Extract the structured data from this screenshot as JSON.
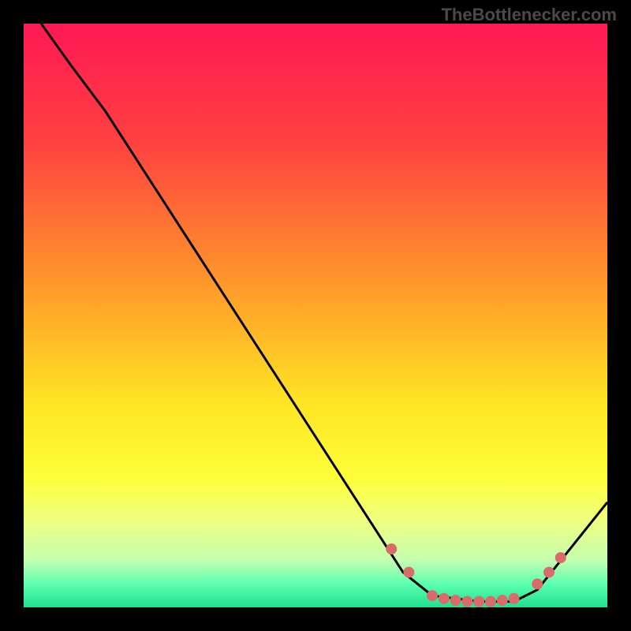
{
  "watermark": "TheBottlenecker.com",
  "chart_data": {
    "type": "line",
    "title": "",
    "xlabel": "",
    "ylabel": "",
    "xlim": [
      0,
      100
    ],
    "ylim": [
      0,
      100
    ],
    "series": [
      {
        "name": "curve",
        "color": "#000000",
        "points": [
          {
            "x": 3,
            "y": 100
          },
          {
            "x": 8,
            "y": 93
          },
          {
            "x": 14,
            "y": 85
          },
          {
            "x": 65,
            "y": 6
          },
          {
            "x": 70,
            "y": 2
          },
          {
            "x": 78,
            "y": 1
          },
          {
            "x": 84,
            "y": 1
          },
          {
            "x": 88,
            "y": 3
          },
          {
            "x": 100,
            "y": 18
          }
        ]
      }
    ],
    "markers": [
      {
        "x": 63,
        "y": 10,
        "color": "#d96b6b"
      },
      {
        "x": 66,
        "y": 6,
        "color": "#d96b6b"
      },
      {
        "x": 70,
        "y": 2,
        "color": "#d96b6b"
      },
      {
        "x": 72,
        "y": 1.5,
        "color": "#d96b6b"
      },
      {
        "x": 74,
        "y": 1.2,
        "color": "#d96b6b"
      },
      {
        "x": 76,
        "y": 1,
        "color": "#d96b6b"
      },
      {
        "x": 78,
        "y": 1,
        "color": "#d96b6b"
      },
      {
        "x": 80,
        "y": 1,
        "color": "#d96b6b"
      },
      {
        "x": 82,
        "y": 1.2,
        "color": "#d96b6b"
      },
      {
        "x": 84,
        "y": 1.5,
        "color": "#d96b6b"
      },
      {
        "x": 88,
        "y": 4,
        "color": "#d96b6b"
      },
      {
        "x": 90,
        "y": 6,
        "color": "#d96b6b"
      },
      {
        "x": 92,
        "y": 8.5,
        "color": "#d96b6b"
      }
    ],
    "gradient_stops": [
      {
        "offset": 0,
        "color": "#ff1955"
      },
      {
        "offset": 20,
        "color": "#ff4040"
      },
      {
        "offset": 45,
        "color": "#ff9a2a"
      },
      {
        "offset": 65,
        "color": "#ffe524"
      },
      {
        "offset": 78,
        "color": "#fdff3a"
      },
      {
        "offset": 85,
        "color": "#f0ff80"
      },
      {
        "offset": 92,
        "color": "#c3ffb0"
      },
      {
        "offset": 96,
        "color": "#5cffb0"
      },
      {
        "offset": 100,
        "color": "#20e090"
      }
    ]
  }
}
